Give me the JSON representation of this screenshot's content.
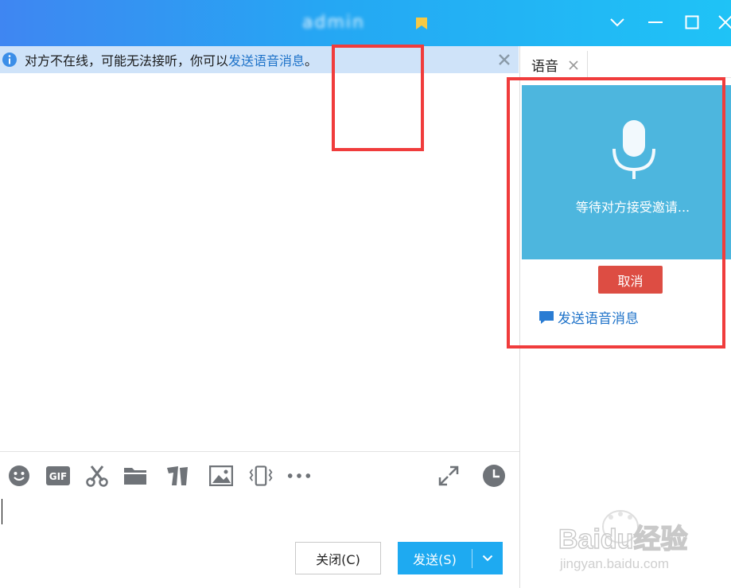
{
  "window": {
    "title": "admin"
  },
  "notice": {
    "text": "对方不在线，可能无法接听，你可以",
    "link": "发送语音消息",
    "suffix": "。"
  },
  "right_panel": {
    "tab_label": "语音",
    "status_text": "等待对方接受邀请...",
    "cancel_label": "取消",
    "send_voice_label": "发送语音消息"
  },
  "toolbar": {
    "gif_label": "GIF",
    "more_label": "···"
  },
  "footer": {
    "close_label": "关闭(C)",
    "send_label": "发送(S)"
  },
  "watermark": {
    "brand": "Baidu经验",
    "url": "jingyan.baidu.com"
  },
  "colors": {
    "titlebar_start": "#3f86f2",
    "titlebar_end": "#1fc3f6",
    "send_button": "#1eaaf1",
    "cancel_button": "#dd4d43",
    "voice_box": "#4db6de",
    "link": "#1f73c9",
    "annotation": "#f03c3c"
  }
}
